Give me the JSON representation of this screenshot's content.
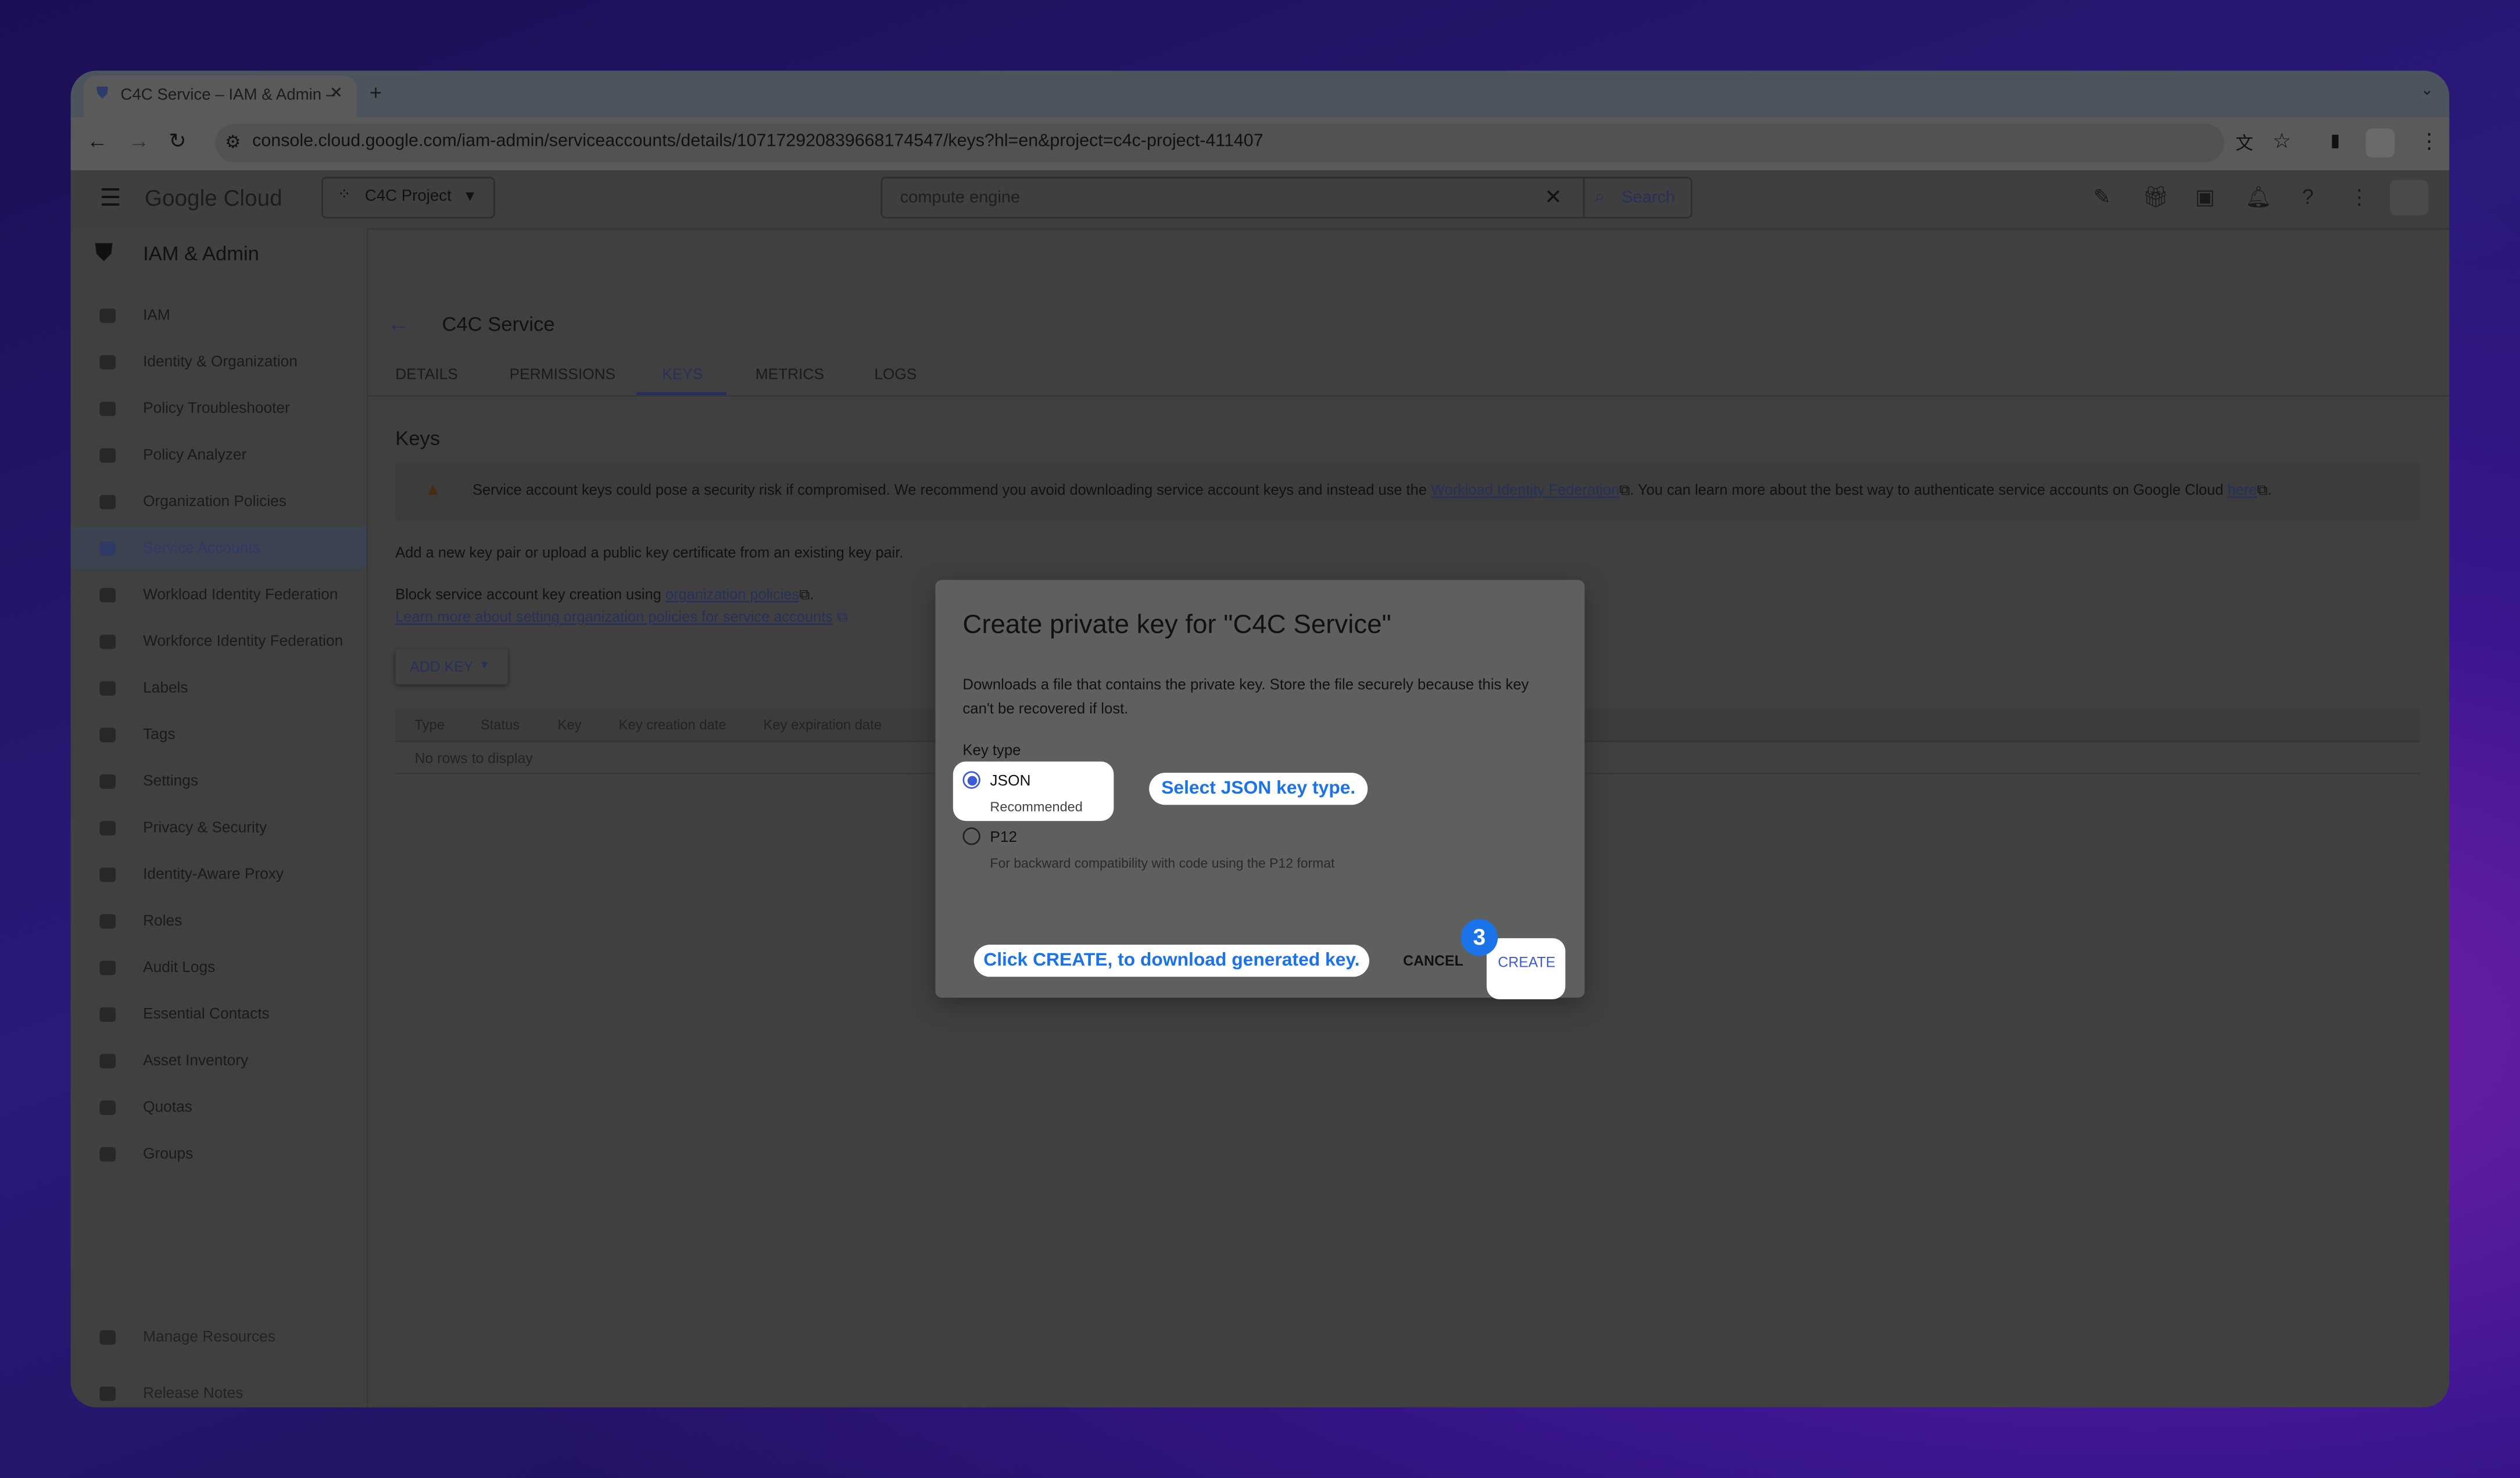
{
  "browser": {
    "tab_title": "C4C Service – IAM & Admin –",
    "url": "console.cloud.google.com/iam-admin/serviceaccounts/details/107172920839668174547/keys?hl=en&project=c4c-project-411407"
  },
  "header": {
    "logo": "Google Cloud",
    "project": "C4C Project",
    "search_value": "compute engine",
    "search_button": "Search"
  },
  "sidebar": {
    "title": "IAM & Admin",
    "items": [
      "IAM",
      "Identity & Organization",
      "Policy Troubleshooter",
      "Policy Analyzer",
      "Organization Policies",
      "Service Accounts",
      "Workload Identity Federation",
      "Workforce Identity Federation",
      "Labels",
      "Tags",
      "Settings",
      "Privacy & Security",
      "Identity-Aware Proxy",
      "Roles",
      "Audit Logs",
      "Essential Contacts",
      "Asset Inventory",
      "Quotas",
      "Groups"
    ],
    "selected": "Service Accounts",
    "bottom": [
      "Manage Resources",
      "Release Notes"
    ],
    "collapse": "<|"
  },
  "page": {
    "title": "C4C Service",
    "tabs": [
      "DETAILS",
      "PERMISSIONS",
      "KEYS",
      "METRICS",
      "LOGS"
    ],
    "active_tab": "KEYS",
    "section": "Keys",
    "warning": {
      "text1": "Service account keys could pose a security risk if compromised. We recommend you avoid downloading service account keys and instead use the",
      "link1": "Workload Identity Federation",
      "text2": ". You can learn more about the best way to authenticate service accounts on Google Cloud",
      "link2": "here",
      "text3": "."
    },
    "intro": "Add a new key pair or upload a public key certificate from an existing key pair.",
    "block_text": "Block service account key creation using",
    "block_link": "organization policies",
    "learn_more": "Learn more about setting organization policies for service accounts",
    "add_key": "ADD KEY",
    "table": {
      "columns": [
        "Type",
        "Status",
        "Key",
        "Key creation date",
        "Key expiration date"
      ],
      "empty": "No rows to display"
    }
  },
  "dialog": {
    "title": "Create private key for \"C4C Service\"",
    "description": "Downloads a file that contains the private key. Store the file securely because this key can't be recovered if lost.",
    "key_type_label": "Key type",
    "options": [
      {
        "label": "JSON",
        "sub": "Recommended",
        "selected": true
      },
      {
        "label": "P12",
        "sub": "For backward compatibility with code using the P12 format",
        "selected": false
      }
    ],
    "cancel": "CANCEL",
    "create": "CREATE"
  },
  "tutorial": {
    "callout1": "Select JSON key type.",
    "callout2": "Click CREATE, to download generated key.",
    "step": "3",
    "accent": "#1a73e8"
  }
}
